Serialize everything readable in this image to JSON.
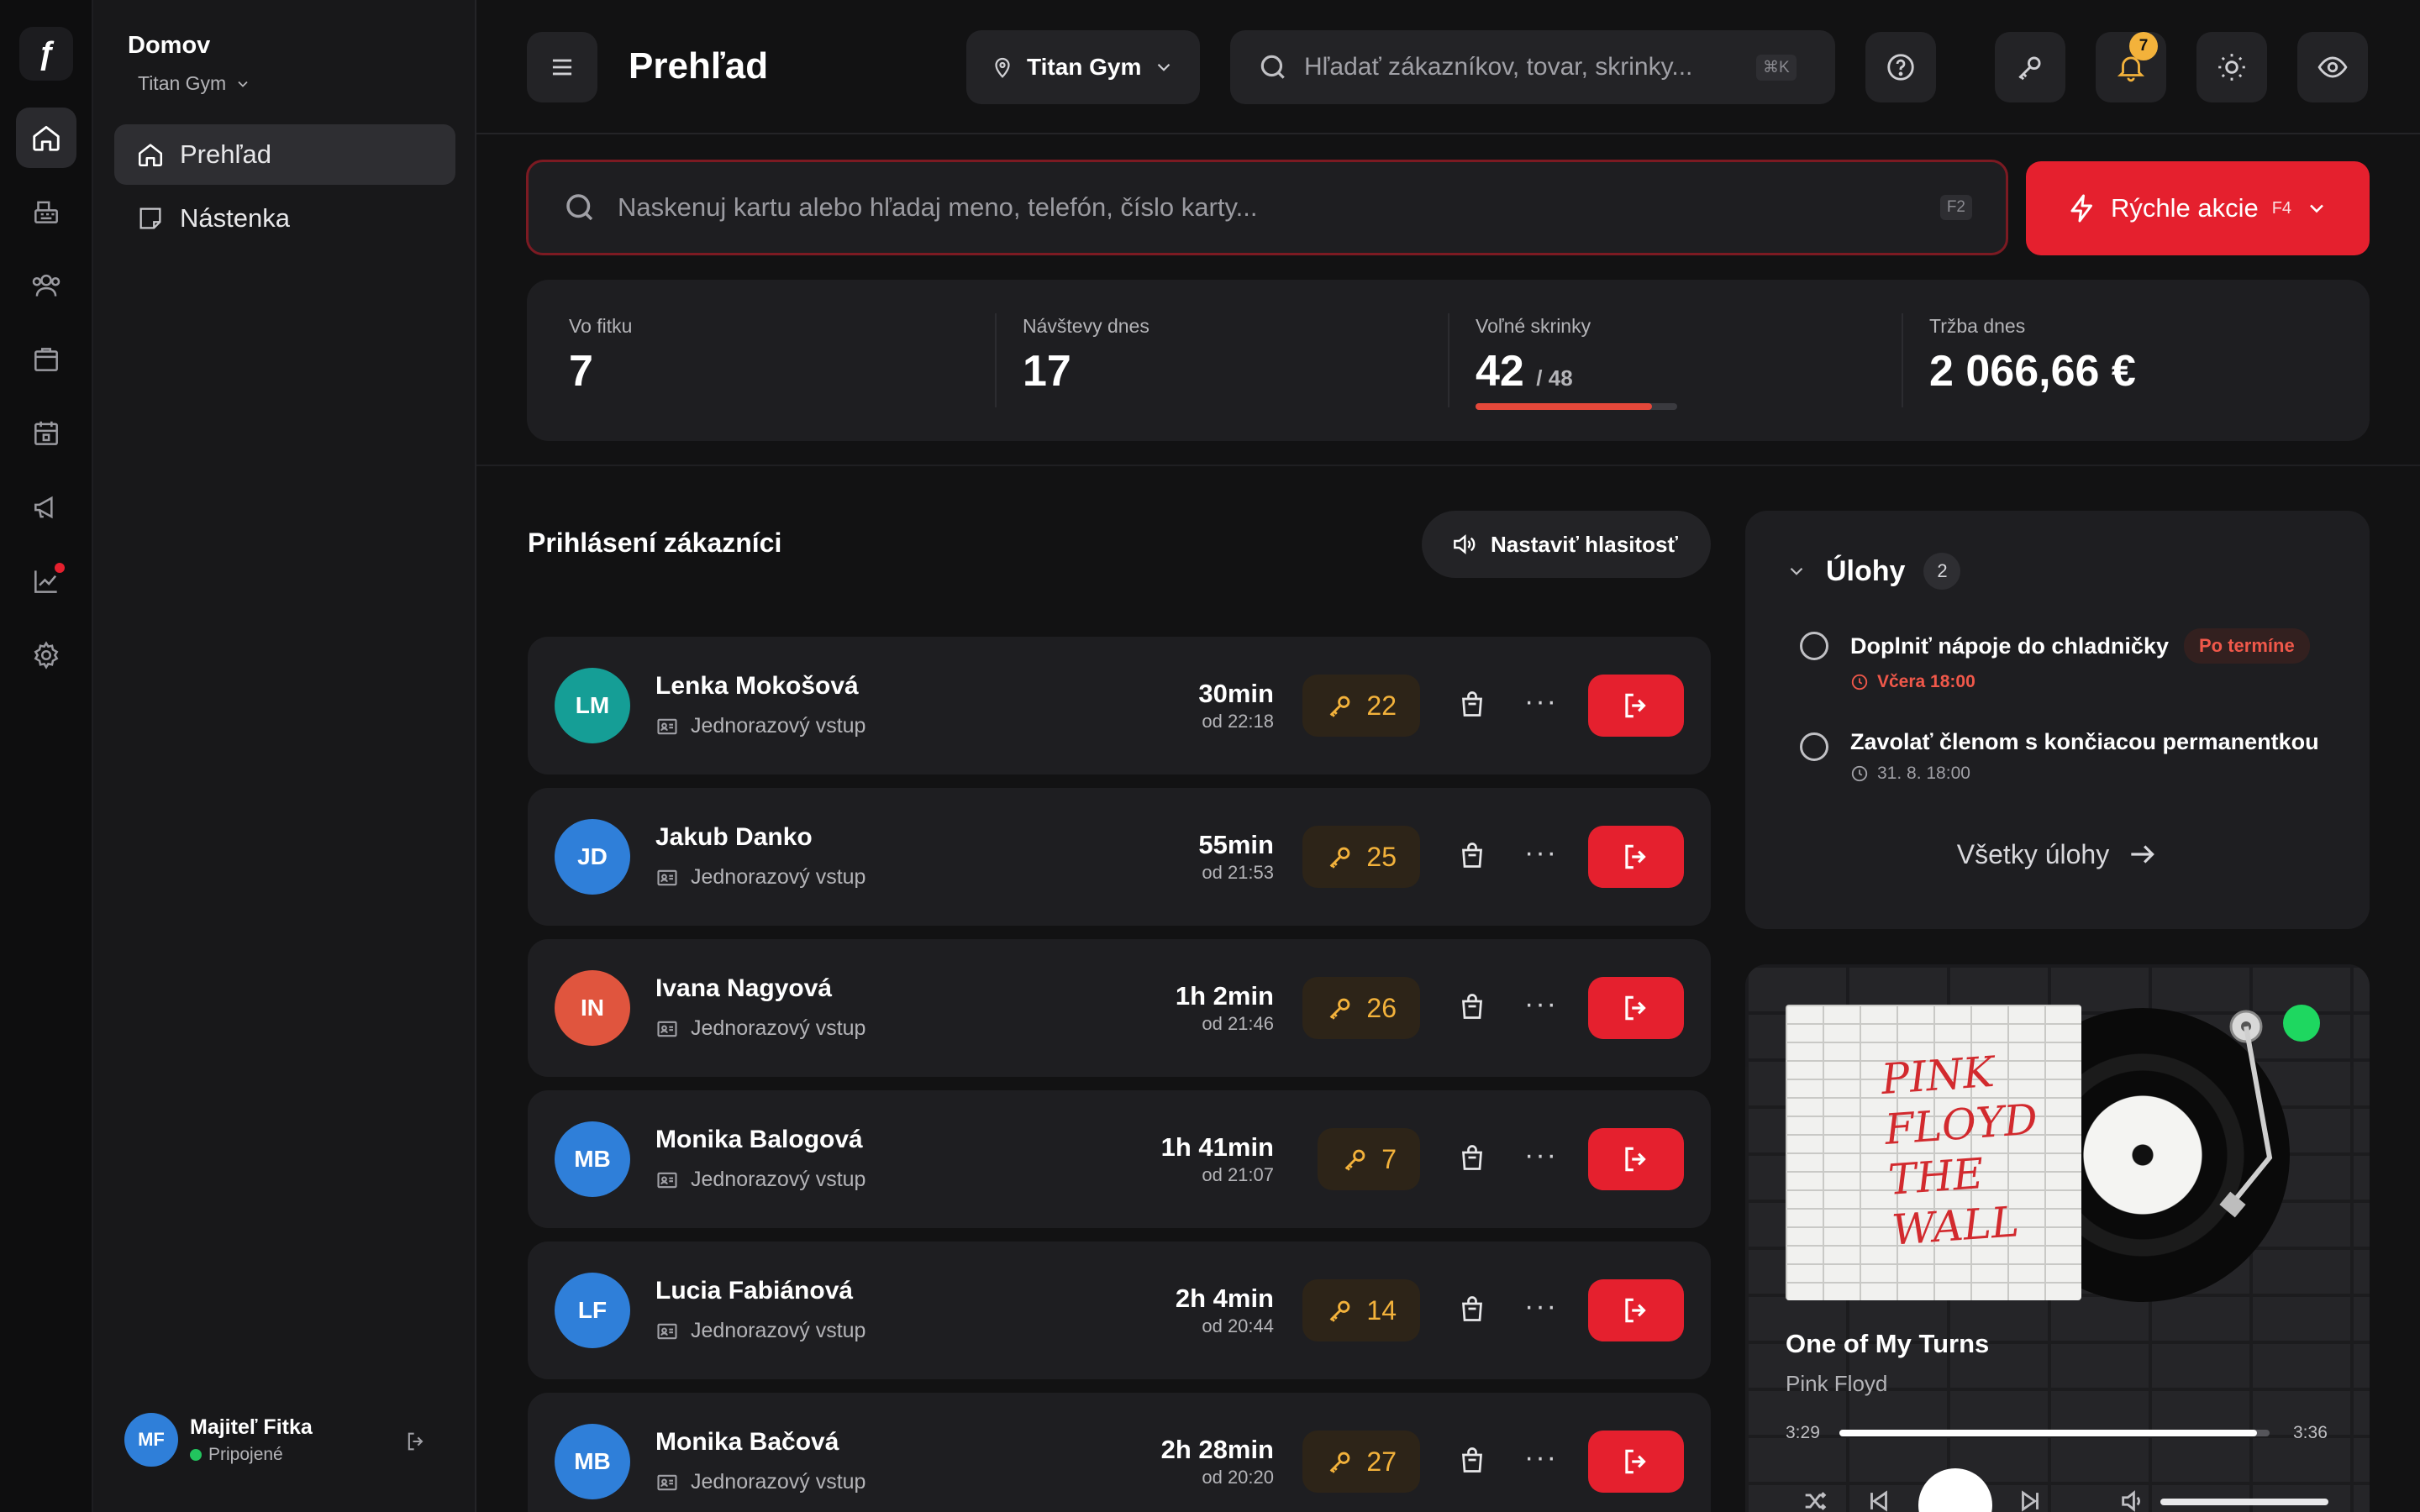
{
  "sidebar": {
    "section_title": "Domov",
    "gym_name": "Titan Gym",
    "items": [
      {
        "label": "Prehľad"
      },
      {
        "label": "Nástenka"
      }
    ],
    "user": {
      "initials": "MF",
      "name": "Majiteľ Fitka",
      "status": "Pripojené"
    }
  },
  "header": {
    "title": "Prehľad",
    "gym_select": "Titan Gym",
    "search_placeholder": "Hľadať zákazníkov, tovar, skrinky...",
    "search_shortcut": "⌘K",
    "notifications_count": "7"
  },
  "scan": {
    "placeholder": "Naskenuj kartu alebo hľadaj meno, telefón, číslo karty...",
    "shortcut": "F2"
  },
  "quick_actions": {
    "label": "Rýchle akcie",
    "shortcut": "F4"
  },
  "stats": {
    "in_gym_label": "Vo fitku",
    "in_gym_value": "7",
    "visits_label": "Návštevy dnes",
    "visits_value": "17",
    "lockers_label": "Voľné skrinky",
    "lockers_free": "42",
    "lockers_total": "/ 48",
    "lockers_fraction": 0.875,
    "revenue_label": "Tržba dnes",
    "revenue_value": "2 066,66 €"
  },
  "customers": {
    "title": "Prihlásení zákazníci",
    "volume_button": "Nastaviť hlasitosť",
    "rows": [
      {
        "initials": "LM",
        "name": "Lenka Mokošová",
        "pass": "Jednorazový vstup",
        "duration": "30min",
        "since": "od 22:18",
        "key": "22",
        "color": "#159e96"
      },
      {
        "initials": "JD",
        "name": "Jakub Danko",
        "pass": "Jednorazový vstup",
        "duration": "55min",
        "since": "od 21:53",
        "key": "25",
        "color": "#2f7fd9"
      },
      {
        "initials": "IN",
        "name": "Ivana Nagyová",
        "pass": "Jednorazový vstup",
        "duration": "1h 2min",
        "since": "od 21:46",
        "key": "26",
        "color": "#e0553e"
      },
      {
        "initials": "MB",
        "name": "Monika Balogová",
        "pass": "Jednorazový vstup",
        "duration": "1h 41min",
        "since": "od 21:07",
        "key": "7",
        "color": "#2f7fd9"
      },
      {
        "initials": "LF",
        "name": "Lucia Fabiánová",
        "pass": "Jednorazový vstup",
        "duration": "2h 4min",
        "since": "od 20:44",
        "key": "14",
        "color": "#2f7fd9"
      },
      {
        "initials": "MB",
        "name": "Monika Bačová",
        "pass": "Jednorazový vstup",
        "duration": "2h 28min",
        "since": "od 20:20",
        "key": "27",
        "color": "#2f7fd9"
      }
    ]
  },
  "tasks": {
    "title": "Úlohy",
    "count": "2",
    "items": [
      {
        "title": "Doplniť nápoje do chladničky",
        "badge": "Po termíne",
        "due": "Včera 18:00",
        "overdue": true
      },
      {
        "title": "Zavolať členom s končiacou permanentkou",
        "badge": "",
        "due": "31. 8. 18:00",
        "overdue": false
      }
    ],
    "all_link": "Všetky úlohy"
  },
  "player": {
    "song": "One of My Turns",
    "artist": "Pink Floyd",
    "current_time": "3:29",
    "total_time": "3:36",
    "progress": 0.97,
    "cover_text": "PINK FLOYD THE WALL"
  },
  "colors": {
    "accent": "#e5202e",
    "key_text": "#f3b23b",
    "overdue": "#f0584a",
    "online": "#22c55e"
  }
}
